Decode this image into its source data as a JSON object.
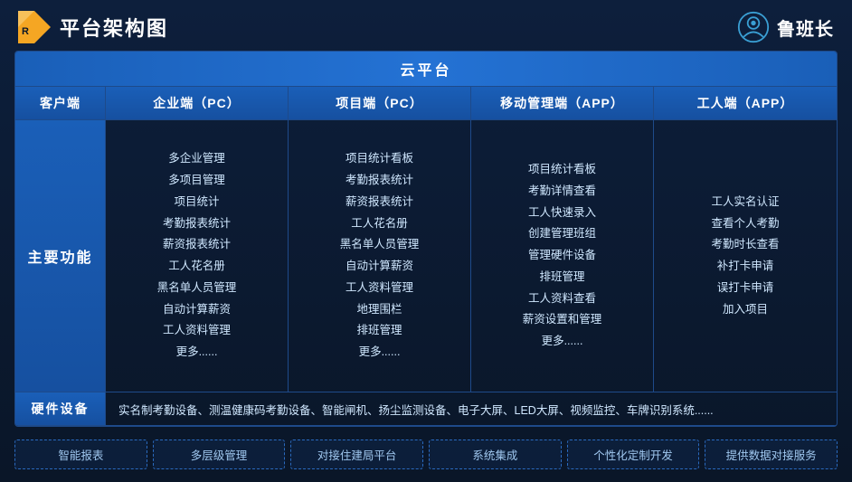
{
  "header": {
    "title": "平台架构图",
    "brand": "鲁班长"
  },
  "cloud": {
    "label": "云平台"
  },
  "columns": {
    "client": "客户端",
    "enterprise": "企业端（PC）",
    "project": "项目端（PC）",
    "mobile": "移动管理端（APP）",
    "worker": "工人端（APP）"
  },
  "row_label": "主要功能",
  "enterprise_items": [
    "多企业管理",
    "多项目管理",
    "项目统计",
    "考勤报表统计",
    "薪资报表统计",
    "工人花名册",
    "黑名单人员管理",
    "自动计算薪资",
    "工人资料管理",
    "更多......"
  ],
  "project_items": [
    "项目统计看板",
    "考勤报表统计",
    "薪资报表统计",
    "工人花名册",
    "黑名单人员管理",
    "自动计算薪资",
    "工人资料管理",
    "地理围栏",
    "排班管理",
    "更多......"
  ],
  "mobile_items": [
    "项目统计看板",
    "考勤详情查看",
    "工人快速录入",
    "创建管理班组",
    "管理硬件设备",
    "排班管理",
    "工人资料查看",
    "薪资设置和管理",
    "更多......"
  ],
  "worker_items": [
    "工人实名认证",
    "查看个人考勤",
    "考勤时长查看",
    "补打卡申请",
    "误打卡申请",
    "加入项目"
  ],
  "hardware": {
    "label": "硬件设备",
    "content": "实名制考勤设备、测温健康码考勤设备、智能闸机、扬尘监测设备、电子大屏、LED大屏、视频监控、车牌识别系统......"
  },
  "features": [
    "智能报表",
    "多层级管理",
    "对接住建局平台",
    "系统集成",
    "个性化定制开发",
    "提供数据对接服务"
  ]
}
